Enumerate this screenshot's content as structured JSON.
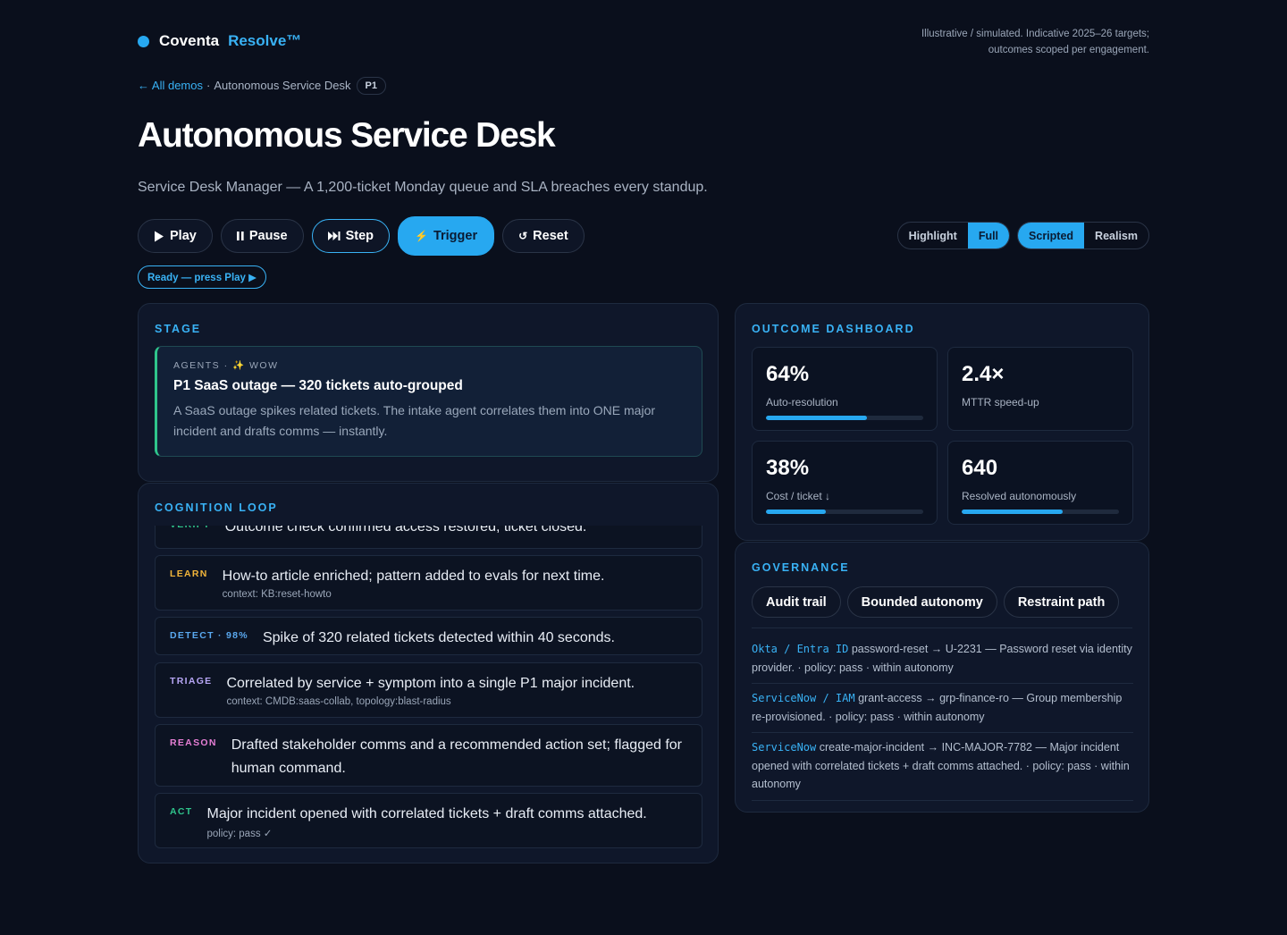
{
  "brand": {
    "name": "Coventa",
    "product": "Resolve™"
  },
  "disclaimer": {
    "line1": "Illustrative / simulated. Indicative 2025–26 targets;",
    "line2": "outcomes scoped per engagement."
  },
  "breadcrumb": {
    "back": "All demos",
    "sep": "·",
    "current": "Autonomous Service Desk",
    "badge": "P1"
  },
  "page": {
    "title": "Autonomous Service Desk",
    "subtitle": "Service Desk Manager — A 1,200-ticket Monday queue and SLA breaches every standup."
  },
  "controls": {
    "play": "Play",
    "pause": "Pause",
    "step": "Step",
    "trigger": "Trigger",
    "reset": "Reset",
    "status": "Ready — press Play ▶"
  },
  "toggles": {
    "view": {
      "options": [
        "Highlight",
        "Full"
      ],
      "selected": "Full"
    },
    "mode": {
      "options": [
        "Scripted",
        "Realism"
      ],
      "selected": "Scripted"
    }
  },
  "stage": {
    "label": "STAGE",
    "kicker": "AGENTS · ✨ WOW",
    "headline": "P1 SaaS outage — 320 tickets auto-grouped",
    "body": "A SaaS outage spikes related tickets. The intake agent correlates them into ONE major incident and drafts comms — instantly."
  },
  "cognition": {
    "label": "COGNITION LOOP",
    "items": [
      {
        "tag": "VERIFY",
        "color": "#2fc58c",
        "text": "Outcome check confirmed access restored; ticket closed.",
        "context": ""
      },
      {
        "tag": "LEARN",
        "color": "#f2b53a",
        "text": "How-to article enriched; pattern added to evals for next time.",
        "context": "context: KB:reset-howto"
      },
      {
        "tag": "DETECT · 98%",
        "color": "#5aa9f0",
        "text": "Spike of 320 related tickets detected within 40 seconds.",
        "context": ""
      },
      {
        "tag": "TRIAGE",
        "color": "#b7a6f5",
        "text": "Correlated by service + symptom into a single P1 major incident.",
        "context": "context: CMDB:saas-collab, topology:blast-radius"
      },
      {
        "tag": "REASON",
        "color": "#e77fd6",
        "text": "Drafted stakeholder comms and a recommended action set; flagged for human command.",
        "context": ""
      },
      {
        "tag": "ACT",
        "color": "#2fc58c",
        "text": "Major incident opened with correlated tickets + draft comms attached.",
        "context": "policy: pass ✓"
      }
    ]
  },
  "outcome": {
    "label": "OUTCOME DASHBOARD",
    "metrics": [
      {
        "value": "64%",
        "label": "Auto-resolution",
        "progress": 0.64
      },
      {
        "value": "2.4×",
        "label": "MTTR speed-up",
        "progress": null
      },
      {
        "value": "38%",
        "label": "Cost / ticket ↓",
        "progress": 0.38
      },
      {
        "value": "640",
        "label": "Resolved autonomously",
        "progress": 0.64
      }
    ]
  },
  "governance": {
    "label": "GOVERNANCE",
    "chips": [
      "Audit trail",
      "Bounded autonomy",
      "Restraint path"
    ],
    "entries": [
      {
        "system": "Okta / Entra ID",
        "text": "password-reset → U-2231 — Password reset via identity provider. · policy: pass · within autonomy"
      },
      {
        "system": "ServiceNow / IAM",
        "text": "grant-access → grp-finance-ro — Group membership re-provisioned. · policy: pass · within autonomy"
      },
      {
        "system": "ServiceNow",
        "text": "create-major-incident → INC-MAJOR-7782 — Major incident opened with correlated tickets + draft comms attached. · policy: pass · within autonomy"
      }
    ]
  }
}
